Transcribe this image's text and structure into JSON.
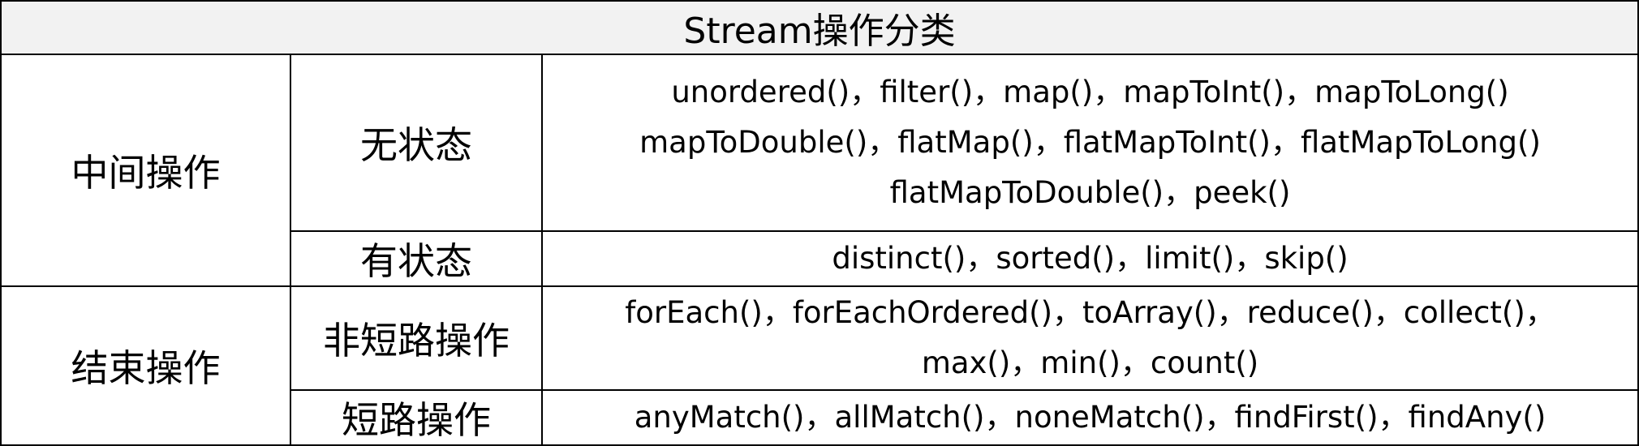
{
  "table": {
    "title": "Stream操作分类",
    "groups": [
      {
        "category": "中间操作",
        "rows": [
          {
            "subcategory": "无状态",
            "lines": [
              "unordered()，filter()，map()，mapToInt()，mapToLong()",
              "mapToDouble()，flatMap()，flatMapToInt()，flatMapToLong()",
              "flatMapToDouble()，peek()"
            ]
          },
          {
            "subcategory": "有状态",
            "lines": [
              "distinct()，sorted()，limit()，skip()"
            ]
          }
        ]
      },
      {
        "category": "结束操作",
        "rows": [
          {
            "subcategory": "非短路操作",
            "lines": [
              "forEach()，forEachOrdered()，toArray()，reduce()，collect()，",
              "max()，min()，count()"
            ]
          },
          {
            "subcategory": "短路操作",
            "lines": [
              "anyMatch()，allMatch()，noneMatch()，findFirst()，findAny()"
            ]
          }
        ]
      }
    ]
  }
}
